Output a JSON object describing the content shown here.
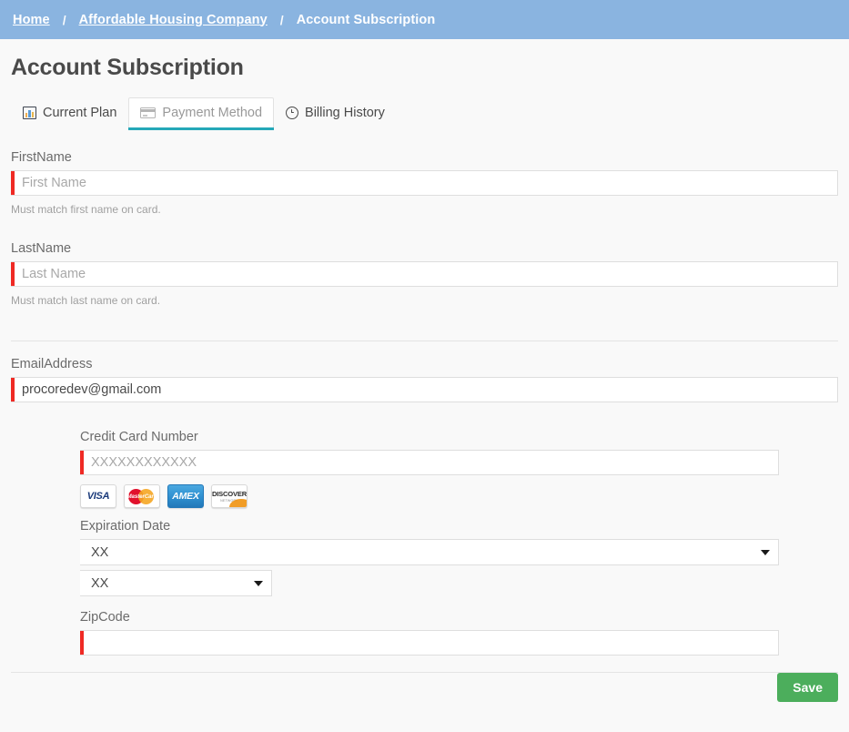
{
  "breadcrumb": {
    "separator": "/",
    "items": [
      {
        "label": "Home"
      },
      {
        "label": "Affordable Housing Company"
      },
      {
        "label": "Account Subscription"
      }
    ]
  },
  "page": {
    "title": "Account Subscription"
  },
  "tabs": [
    {
      "label": "Current Plan",
      "icon": "bar-chart-icon",
      "active": false
    },
    {
      "label": "Payment Method",
      "icon": "credit-card-icon",
      "active": true
    },
    {
      "label": "Billing History",
      "icon": "clock-icon",
      "active": false
    }
  ],
  "form": {
    "first_name": {
      "label": "FirstName",
      "placeholder": "First Name",
      "value": "",
      "help": "Must match first name on card."
    },
    "last_name": {
      "label": "LastName",
      "placeholder": "Last Name",
      "value": "",
      "help": "Must match last name on card."
    },
    "email": {
      "label": "EmailAddress",
      "placeholder": "",
      "value": "procoredev@gmail.com"
    },
    "credit_card": {
      "label": "Credit Card Number",
      "placeholder": "XXXXXXXXXXXX",
      "value": ""
    },
    "expiration": {
      "label": "Expiration Date",
      "month": {
        "value": "XX"
      },
      "year": {
        "value": "XX"
      }
    },
    "zip": {
      "label": "ZipCode",
      "placeholder": "",
      "value": ""
    }
  },
  "card_brands": [
    {
      "name": "visa-logo",
      "text": "VISA"
    },
    {
      "name": "mastercard-logo",
      "text": "MasterCard"
    },
    {
      "name": "amex-logo",
      "text": "AMEX"
    },
    {
      "name": "discover-logo",
      "text": "DISCOVER",
      "subtext": "NETWORK"
    }
  ],
  "footer": {
    "save_label": "Save"
  },
  "colors": {
    "breadcrumb_bg": "#8ab4e0",
    "accent_teal": "#25a8b8",
    "required_red": "#ef2a24",
    "save_green": "#4cae5c"
  }
}
